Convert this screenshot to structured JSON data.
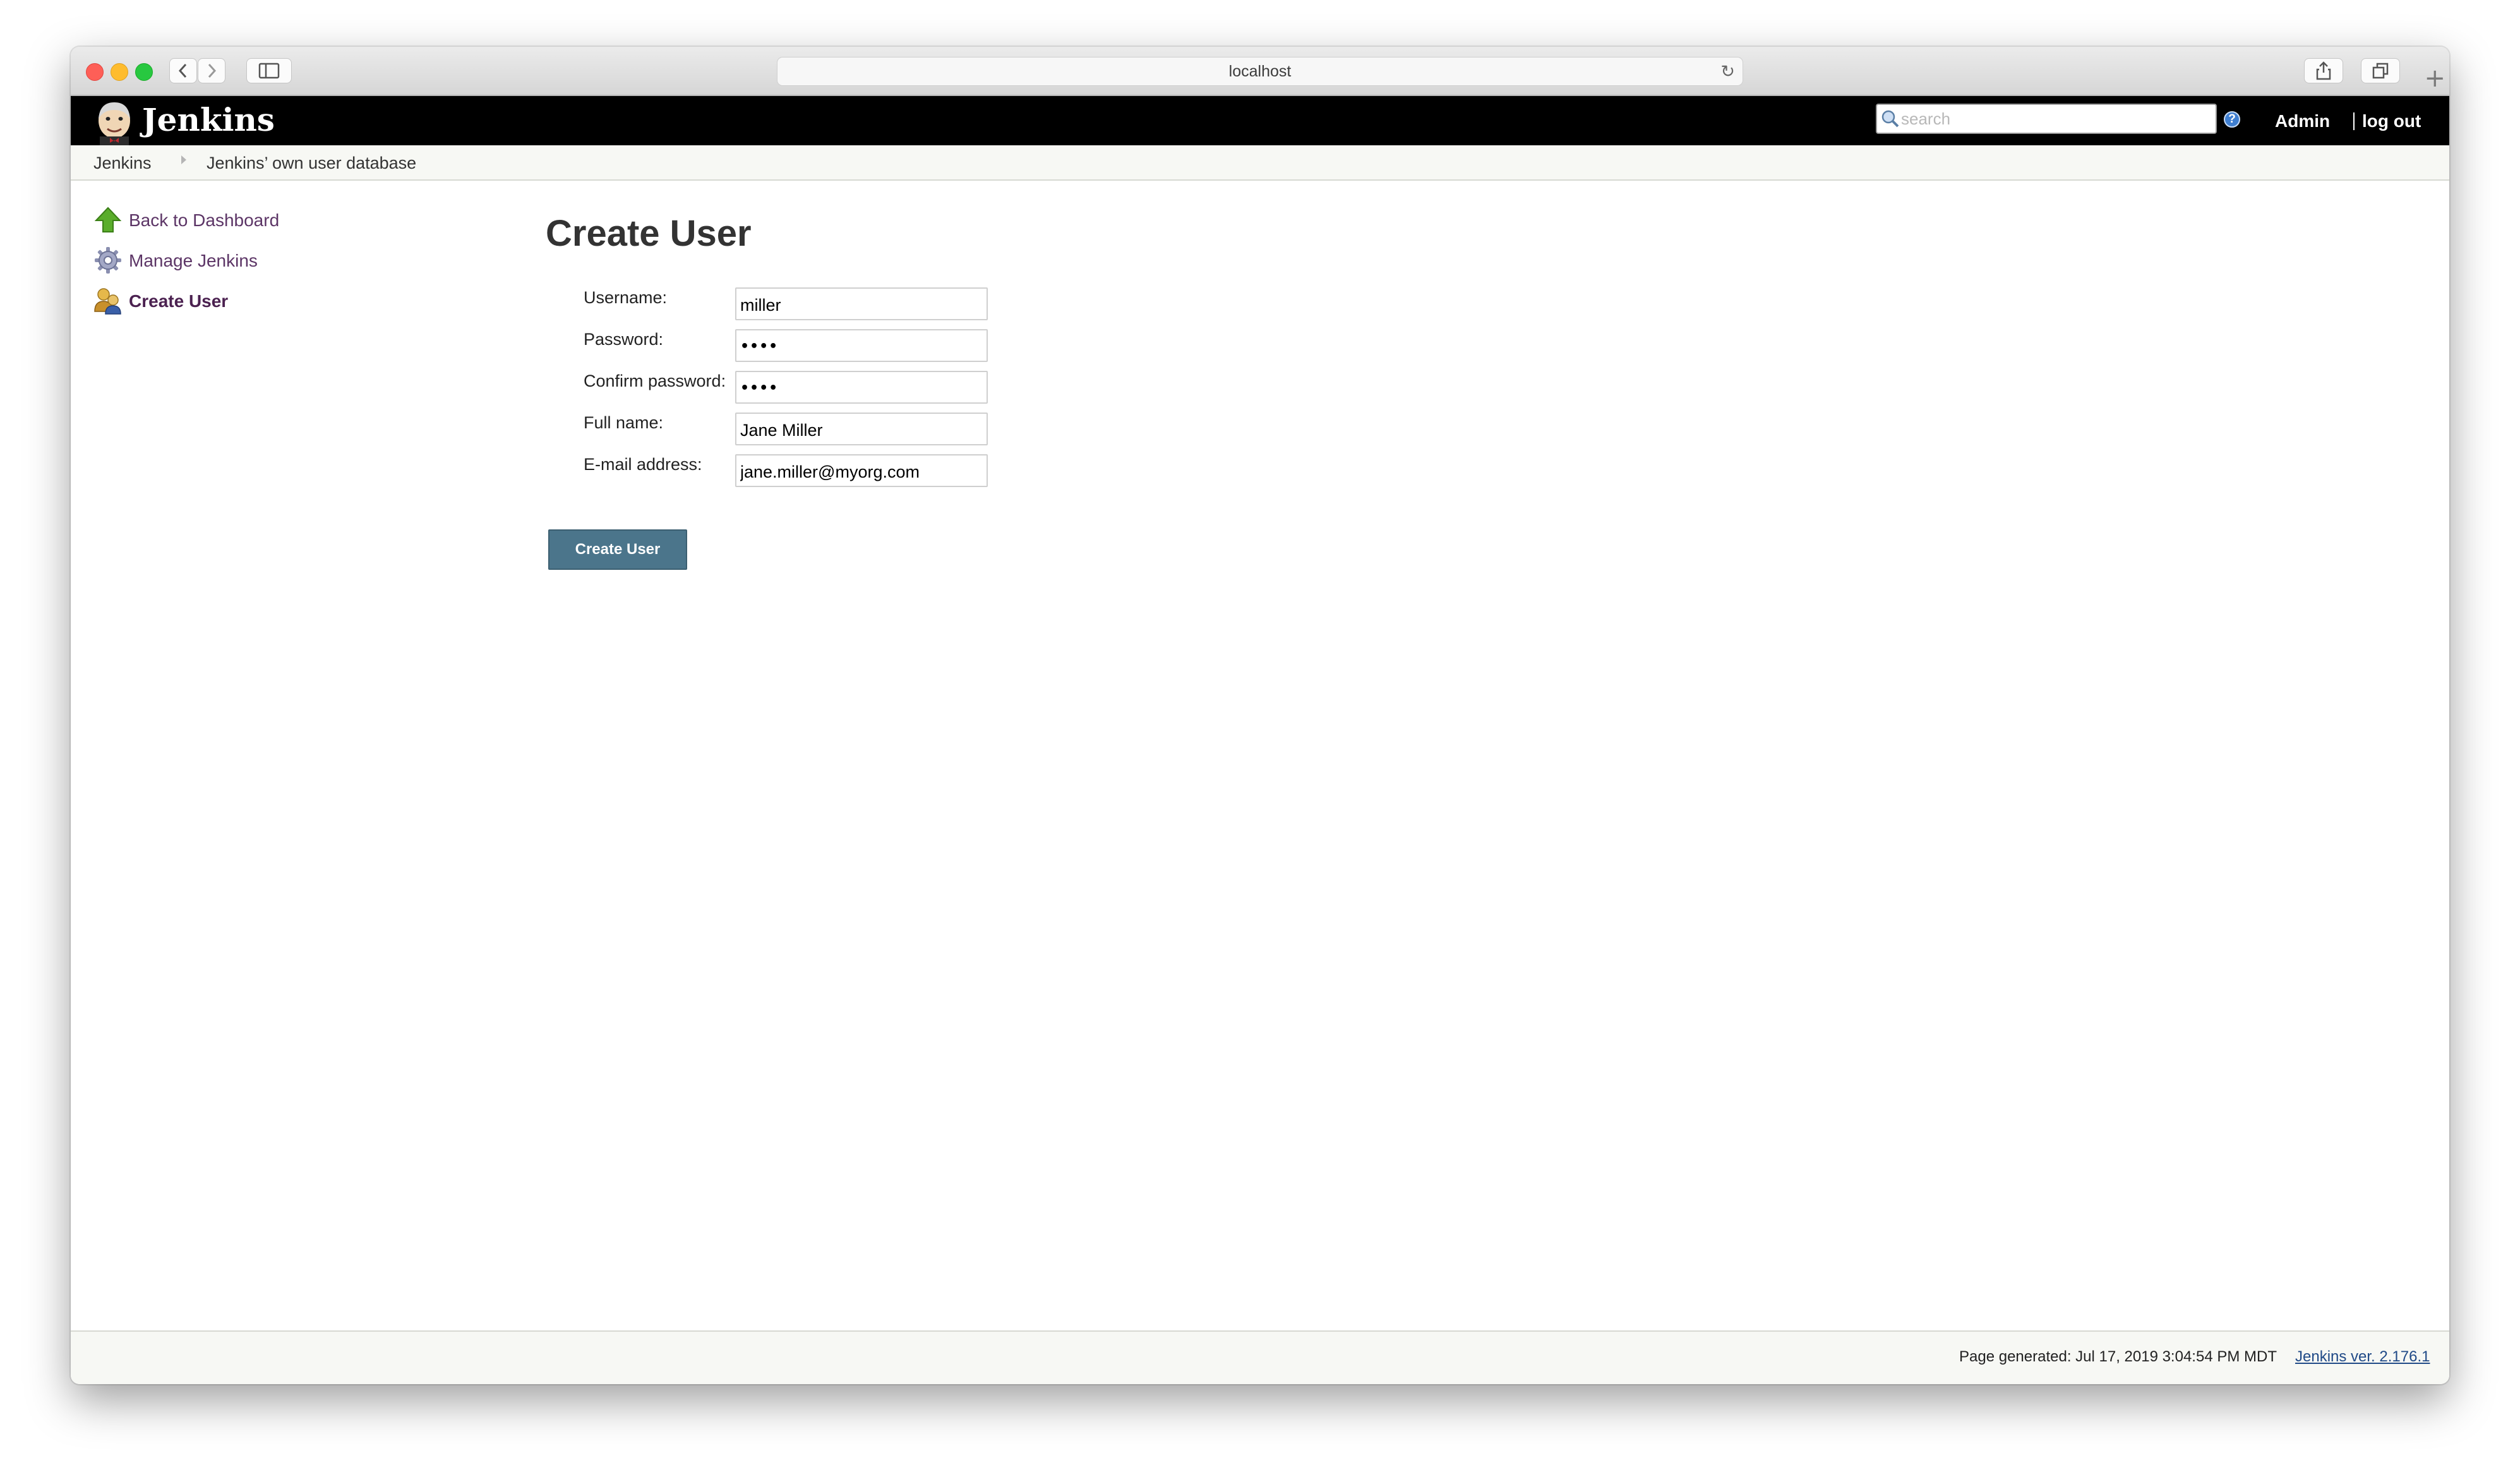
{
  "browser": {
    "url": "localhost"
  },
  "header": {
    "title": "Jenkins",
    "search_placeholder": "search",
    "help_icon_text": "?",
    "user_label": "Admin",
    "logout_label": "log out"
  },
  "breadcrumb": [
    "Jenkins",
    "Jenkins’ own user database"
  ],
  "sidebar": {
    "items": [
      {
        "label": "Back to Dashboard",
        "icon": "up-arrow-icon"
      },
      {
        "label": "Manage Jenkins",
        "icon": "gear-icon"
      },
      {
        "label": "Create User",
        "icon": "users-icon",
        "current": true
      }
    ]
  },
  "main": {
    "title": "Create User",
    "fields": [
      {
        "label": "Username:",
        "value": "miller",
        "type": "text"
      },
      {
        "label": "Password:",
        "value": "••••",
        "type": "password"
      },
      {
        "label": "Confirm password:",
        "value": "••••",
        "type": "password"
      },
      {
        "label": "Full name:",
        "value": "Jane Miller",
        "type": "text"
      },
      {
        "label": "E-mail address:",
        "value": "jane.miller@myorg.com",
        "type": "text"
      }
    ],
    "submit_label": "Create User"
  },
  "footer": {
    "generated": "Page generated: Jul 17, 2019 3:04:54 PM MDT",
    "version_link": "Jenkins ver. 2.176.1"
  },
  "colors": {
    "header_bg": "#000000",
    "link": "#5c3566",
    "button_bg": "#4b758b",
    "breadcrumb_bg": "#f7f8f4"
  }
}
